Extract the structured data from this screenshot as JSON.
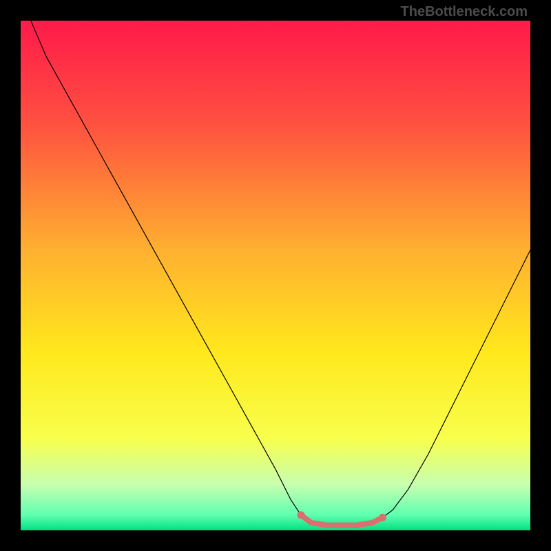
{
  "watermark": "TheBottleneck.com",
  "chart_data": {
    "type": "line",
    "title": "",
    "xlabel": "",
    "ylabel": "",
    "xlim": [
      0,
      100
    ],
    "ylim": [
      0,
      100
    ],
    "grid": false,
    "background_gradient": {
      "stops": [
        {
          "offset": 0,
          "color": "#ff1a4a"
        },
        {
          "offset": 20,
          "color": "#ff5040"
        },
        {
          "offset": 45,
          "color": "#ffb030"
        },
        {
          "offset": 65,
          "color": "#ffe81c"
        },
        {
          "offset": 82,
          "color": "#f8ff4c"
        },
        {
          "offset": 91,
          "color": "#c8ffb0"
        },
        {
          "offset": 97,
          "color": "#60ffb0"
        },
        {
          "offset": 100,
          "color": "#00e080"
        }
      ]
    },
    "series": [
      {
        "name": "curve",
        "color": "#000000",
        "width": 1.2,
        "points": [
          {
            "x": 2,
            "y": 100
          },
          {
            "x": 5,
            "y": 93
          },
          {
            "x": 10,
            "y": 84
          },
          {
            "x": 15,
            "y": 75
          },
          {
            "x": 20,
            "y": 66
          },
          {
            "x": 25,
            "y": 57
          },
          {
            "x": 30,
            "y": 48
          },
          {
            "x": 35,
            "y": 39
          },
          {
            "x": 40,
            "y": 30
          },
          {
            "x": 45,
            "y": 21
          },
          {
            "x": 50,
            "y": 12
          },
          {
            "x": 53,
            "y": 6
          },
          {
            "x": 55,
            "y": 3
          },
          {
            "x": 57,
            "y": 1.5
          },
          {
            "x": 60,
            "y": 1
          },
          {
            "x": 63,
            "y": 1
          },
          {
            "x": 66,
            "y": 1
          },
          {
            "x": 69,
            "y": 1.5
          },
          {
            "x": 71,
            "y": 2.5
          },
          {
            "x": 73,
            "y": 4
          },
          {
            "x": 76,
            "y": 8
          },
          {
            "x": 80,
            "y": 15
          },
          {
            "x": 85,
            "y": 25
          },
          {
            "x": 90,
            "y": 35
          },
          {
            "x": 95,
            "y": 45
          },
          {
            "x": 100,
            "y": 55
          }
        ]
      },
      {
        "name": "highlight",
        "color": "#d96f6f",
        "width": 8,
        "points": [
          {
            "x": 55,
            "y": 3
          },
          {
            "x": 57,
            "y": 1.5
          },
          {
            "x": 60,
            "y": 1
          },
          {
            "x": 63,
            "y": 1
          },
          {
            "x": 66,
            "y": 1
          },
          {
            "x": 69,
            "y": 1.5
          },
          {
            "x": 71,
            "y": 2.5
          }
        ],
        "endpoint_dots": true
      }
    ]
  }
}
